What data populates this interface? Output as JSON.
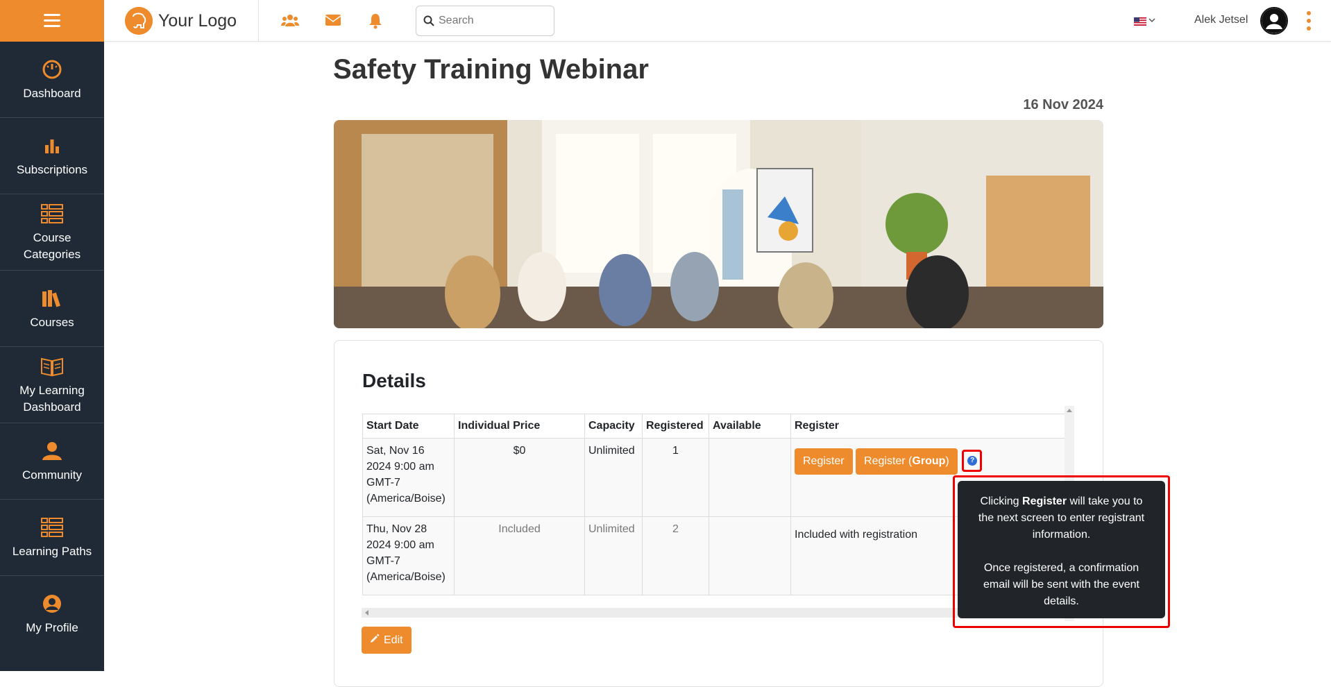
{
  "sidebar": {
    "items": [
      {
        "label": "Dashboard",
        "icon": "gauge-icon"
      },
      {
        "label": "Subscriptions",
        "icon": "bar-chart-icon"
      },
      {
        "label": "Course Categories",
        "icon": "list-icon"
      },
      {
        "label": "Courses",
        "icon": "books-icon"
      },
      {
        "label": "My Learning Dashboard",
        "icon": "open-book-icon"
      },
      {
        "label": "Community",
        "icon": "community-icon"
      },
      {
        "label": "Learning Paths",
        "icon": "list-icon"
      },
      {
        "label": "My Profile",
        "icon": "user-circle-icon"
      }
    ]
  },
  "header": {
    "logo_text": "Your Logo",
    "search_placeholder": "Search",
    "user_name": "Alek Jetsel"
  },
  "page": {
    "title": "Safety Training Webinar",
    "date": "16 Nov 2024"
  },
  "details": {
    "title": "Details",
    "columns": [
      "Start Date",
      "Individual Price",
      "Capacity",
      "Registered",
      "Available",
      "Register"
    ],
    "rows": [
      {
        "start_line1": "Sat, Nov 16",
        "start_line2": "2024 9:00 am",
        "start_line3": "GMT-7",
        "start_line4": "(America/Boise)",
        "price": "$0",
        "capacity": "Unlimited",
        "registered": "1",
        "available": ""
      },
      {
        "start_line1": "Thu, Nov 28",
        "start_line2": "2024 9:00 am",
        "start_line3": "GMT-7",
        "start_line4": "(America/Boise)",
        "price": "Included",
        "capacity": "Unlimited",
        "registered": "2",
        "available": "",
        "register_text": "Included with registration"
      }
    ],
    "register_button": "Register",
    "register_group_prefix": "Register (",
    "register_group_bold": "Group",
    "register_group_suffix": ")",
    "help_glyph": "?",
    "edit_button": "Edit"
  },
  "tooltip": {
    "line1_prefix": "Clicking ",
    "line1_bold": "Register",
    "line1_suffix": " will take you to the next screen to enter registrant information.",
    "line2": "Once registered, a confirmation email will be sent with the event details."
  },
  "colors": {
    "accent": "#ee8b2c",
    "sidebar_bg": "#1f2a36",
    "tooltip_bg": "#212529",
    "highlight": "#e00000"
  }
}
